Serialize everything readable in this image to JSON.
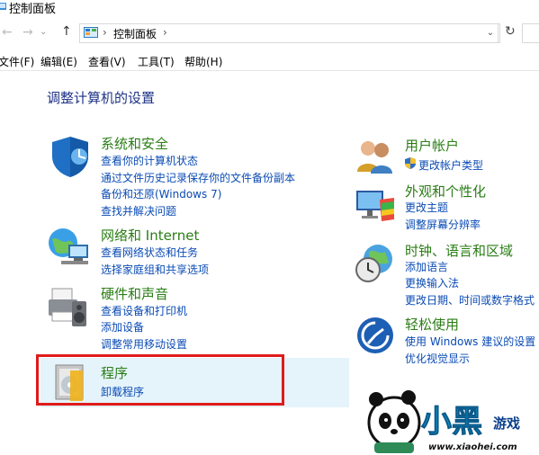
{
  "window": {
    "title": "控制面板"
  },
  "nav": {
    "back": "←",
    "forward": "→",
    "up": "↑",
    "dropdown": "⌄",
    "refresh": "↻"
  },
  "address": {
    "separator1": "›",
    "location": "控制面板",
    "separator2": "›"
  },
  "menu": [
    "文件(F)",
    "编辑(E)",
    "查看(V)",
    "工具(T)",
    "帮助(H)"
  ],
  "heading": "调整计算机的设置",
  "categories": {
    "system_security": {
      "title": "系统和安全",
      "links": [
        "查看你的计算机状态",
        "通过文件历史记录保存你的文件备份副本",
        "备份和还原(Windows 7)",
        "查找并解决问题"
      ]
    },
    "network": {
      "title": "网络和 Internet",
      "links": [
        "查看网络状态和任务",
        "选择家庭组和共享选项"
      ]
    },
    "hardware": {
      "title": "硬件和声音",
      "links": [
        "查看设备和打印机",
        "添加设备",
        "调整常用移动设置"
      ]
    },
    "programs": {
      "title": "程序",
      "links": [
        "卸载程序"
      ]
    },
    "user_accounts": {
      "title": "用户帐户",
      "links": [
        "更改帐户类型"
      ]
    },
    "appearance": {
      "title": "外观和个性化",
      "links": [
        "更改主题",
        "调整屏幕分辨率"
      ]
    },
    "clock": {
      "title": "时钟、语言和区域",
      "links": [
        "添加语言",
        "更换输入法",
        "更改日期、时间或数字格式"
      ]
    },
    "ease": {
      "title": "轻松使用",
      "links": [
        "使用 Windows 建议的设置",
        "优化视觉显示"
      ]
    }
  },
  "watermark": {
    "big": "小黑",
    "small": "游戏",
    "url": "www.xiaohei.com"
  },
  "colors": {
    "heading": "#1e3287",
    "category": "#2a7d15",
    "link": "#0a4bb4",
    "highlight": "#e5f3fb",
    "annotation": "#e01b1b"
  }
}
